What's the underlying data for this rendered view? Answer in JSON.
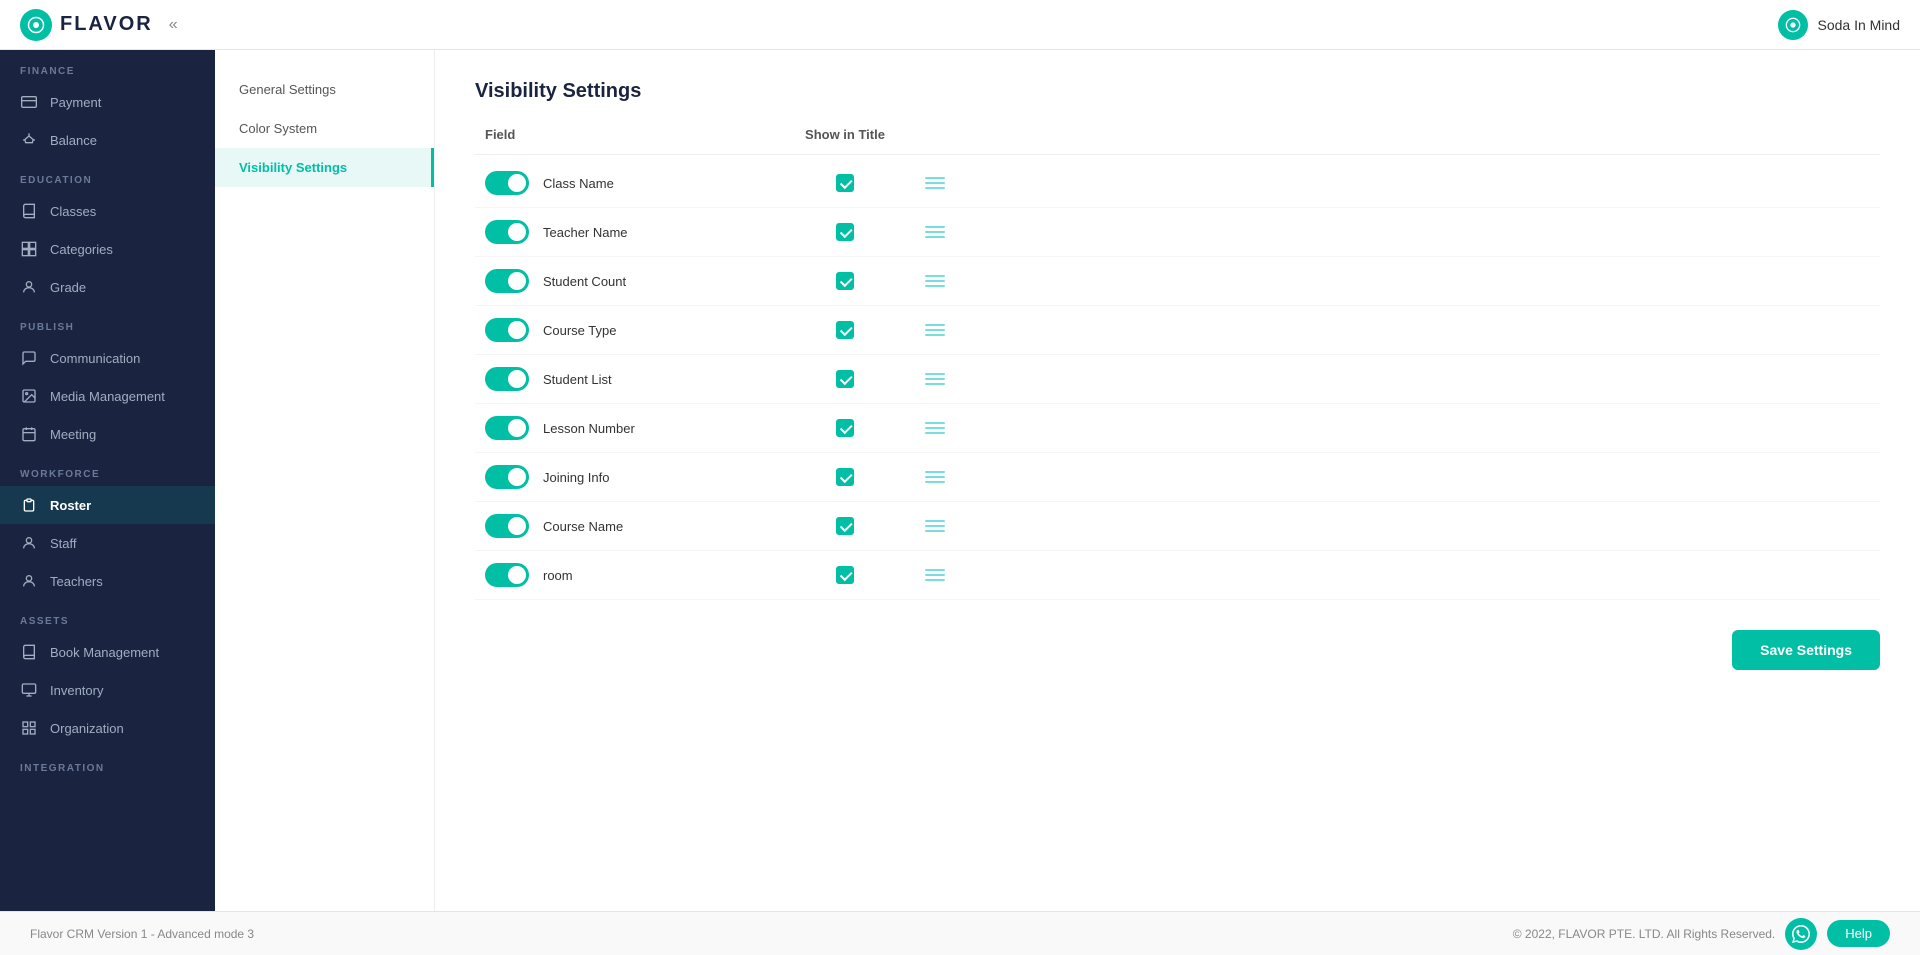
{
  "header": {
    "logo_text": "FLAVOR",
    "logo_icon": "F",
    "collapse_icon": "«",
    "brand_icon": "☺",
    "brand_name": "Soda In Mind"
  },
  "sidebar": {
    "sections": [
      {
        "label": "FINANCE",
        "items": [
          {
            "id": "payment",
            "label": "Payment",
            "icon": "💳"
          },
          {
            "id": "balance",
            "label": "Balance",
            "icon": "⚖"
          }
        ]
      },
      {
        "label": "EDUCATION",
        "items": [
          {
            "id": "classes",
            "label": "Classes",
            "icon": "📖"
          },
          {
            "id": "categories",
            "label": "Categories",
            "icon": "📂"
          },
          {
            "id": "grade",
            "label": "Grade",
            "icon": "👤"
          }
        ]
      },
      {
        "label": "PUBLISH",
        "items": [
          {
            "id": "communication",
            "label": "Communication",
            "icon": "💬"
          },
          {
            "id": "media-management",
            "label": "Media Management",
            "icon": "🖼"
          },
          {
            "id": "meeting",
            "label": "Meeting",
            "icon": "🗓"
          }
        ]
      },
      {
        "label": "WORKFORCE",
        "items": [
          {
            "id": "roster",
            "label": "Roster",
            "icon": "📋",
            "active": true
          },
          {
            "id": "staff",
            "label": "Staff",
            "icon": "👤"
          },
          {
            "id": "teachers",
            "label": "Teachers",
            "icon": "🎓"
          }
        ]
      },
      {
        "label": "ASSETS",
        "items": [
          {
            "id": "book-management",
            "label": "Book Management",
            "icon": "📚"
          },
          {
            "id": "inventory",
            "label": "Inventory",
            "icon": "📦"
          },
          {
            "id": "organization",
            "label": "Organization",
            "icon": "🏢"
          }
        ]
      },
      {
        "label": "INTEGRATION",
        "items": []
      }
    ]
  },
  "sub_nav": {
    "items": [
      {
        "id": "general-settings",
        "label": "General Settings",
        "active": false
      },
      {
        "id": "color-system",
        "label": "Color System",
        "active": false
      },
      {
        "id": "visibility-settings",
        "label": "Visibility Settings",
        "active": true
      }
    ]
  },
  "main": {
    "title": "Visibility Settings",
    "table_headers": {
      "field": "Field",
      "show_in_title": "Show in Title"
    },
    "rows": [
      {
        "id": "class-name",
        "label": "Class Name",
        "toggle_on": true,
        "checked": true
      },
      {
        "id": "teacher-name",
        "label": "Teacher Name",
        "toggle_on": true,
        "checked": true
      },
      {
        "id": "student-count",
        "label": "Student Count",
        "toggle_on": true,
        "checked": true
      },
      {
        "id": "course-type",
        "label": "Course Type",
        "toggle_on": true,
        "checked": true
      },
      {
        "id": "student-list",
        "label": "Student List",
        "toggle_on": true,
        "checked": true
      },
      {
        "id": "lesson-number",
        "label": "Lesson Number",
        "toggle_on": true,
        "checked": true
      },
      {
        "id": "joining-info",
        "label": "Joining Info",
        "toggle_on": true,
        "checked": true
      },
      {
        "id": "course-name",
        "label": "Course Name",
        "toggle_on": true,
        "checked": true
      },
      {
        "id": "room",
        "label": "room",
        "toggle_on": true,
        "checked": true
      }
    ],
    "save_button": "Save Settings"
  },
  "footer": {
    "version_text": "Flavor CRM Version 1 - Advanced mode 3",
    "copyright": "© 2022, FLAVOR PTE. LTD. All Rights Reserved.",
    "whatsapp_icon": "✉",
    "help_label": "Help"
  }
}
